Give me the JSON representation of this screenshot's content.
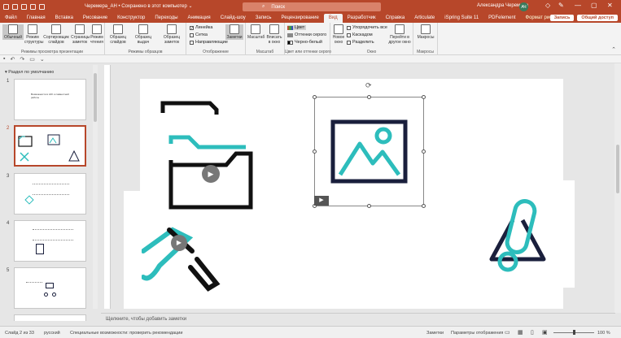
{
  "titlebar": {
    "file_title": "Черемера_АН • Сохранено в этот компьютер ⌄",
    "search_placeholder": "Поиск",
    "user_name": "Александра Черемера",
    "user_initials": "АЧ"
  },
  "tabs": [
    "Файл",
    "Главная",
    "Вставка",
    "Рисование",
    "Конструктор",
    "Переходы",
    "Анимация",
    "Слайд-шоу",
    "Запись",
    "Рецензирование",
    "Вид",
    "Разработчик",
    "Справка",
    "Articulate",
    "iSpring Suite 11",
    "PDFelement",
    "Формат рисунка"
  ],
  "active_tab": "Вид",
  "share": {
    "record": "Запись",
    "share": "Общий доступ"
  },
  "ribbon": {
    "views": {
      "buttons": [
        "Обычный",
        "Режим структуры",
        "Сортировщик слайдов",
        "Страницы заметок",
        "Режим чтения"
      ],
      "label": "Режимы просмотра презентации"
    },
    "masters": {
      "buttons": [
        "Образец слайдов",
        "Образец выдач",
        "Образец заметок"
      ],
      "label": "Режимы образцов"
    },
    "show": {
      "items": [
        "Линейка",
        "Сетка",
        "Направляющие"
      ],
      "checked": [
        true,
        false,
        false
      ],
      "label": "Отображение"
    },
    "notes": {
      "button": "Заметки"
    },
    "zoom": {
      "buttons": [
        "Масштаб",
        "Вписать в окно"
      ],
      "label": "Масштаб"
    },
    "color": {
      "items": [
        "Цвет",
        "Оттенки серого",
        "Черно-белый"
      ],
      "label": "Цвет или оттенки серого"
    },
    "window": {
      "new": "Новое окно",
      "items": [
        "Упорядочить все",
        "Каскадом",
        "Разделить"
      ],
      "switch": "Перейти в другое окно",
      "label": "Окно"
    },
    "macros": {
      "button": "Макросы",
      "label": "Макросы"
    }
  },
  "left_pane": {
    "section": "Раздел по умолчанию",
    "slides": [
      {
        "num": "1",
        "text": "Возможности в AIO и совместной работы"
      },
      {
        "num": "2",
        "text": ""
      },
      {
        "num": "3",
        "text": ""
      },
      {
        "num": "4",
        "text": ""
      },
      {
        "num": "5",
        "text": ""
      }
    ]
  },
  "notes_placeholder": "Щелкните, чтобы добавить заметки",
  "status": {
    "slide": "Слайд 2 из 33",
    "lang": "русский",
    "accessibility": "Специальные возможности: проверить рекомендации",
    "notes": "Заметки",
    "display": "Параметры отображения",
    "zoom": "100 %"
  },
  "colors": {
    "accent": "#b7472a",
    "teal": "#2dbdbc",
    "navy": "#1a1f3c"
  }
}
